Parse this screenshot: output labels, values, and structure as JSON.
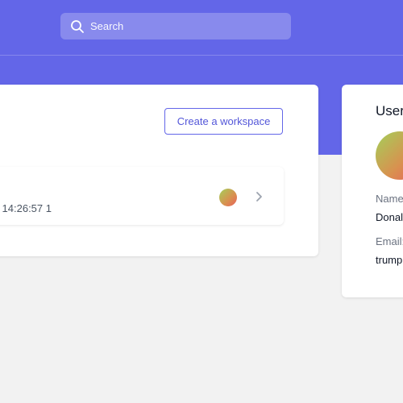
{
  "header": {
    "search": {
      "placeholder": "Search",
      "icon": "search-icon"
    }
  },
  "workspaces": {
    "create_button_label": "Create a workspace",
    "items": [
      {
        "timestamp_partial": "1 14:26:57",
        "avatar": "gradient-avatar",
        "chevron": "chevron-right-icon"
      }
    ]
  },
  "user": {
    "title": "User",
    "name_label": "Name",
    "name_value": "Donal",
    "email_label": "Email:",
    "email_value": "trump"
  },
  "colors": {
    "brand": "#6366e8",
    "background": "#f2f2f2",
    "avatar_gradient": [
      "#a3d05a",
      "#d9904f",
      "#e8605d"
    ]
  }
}
